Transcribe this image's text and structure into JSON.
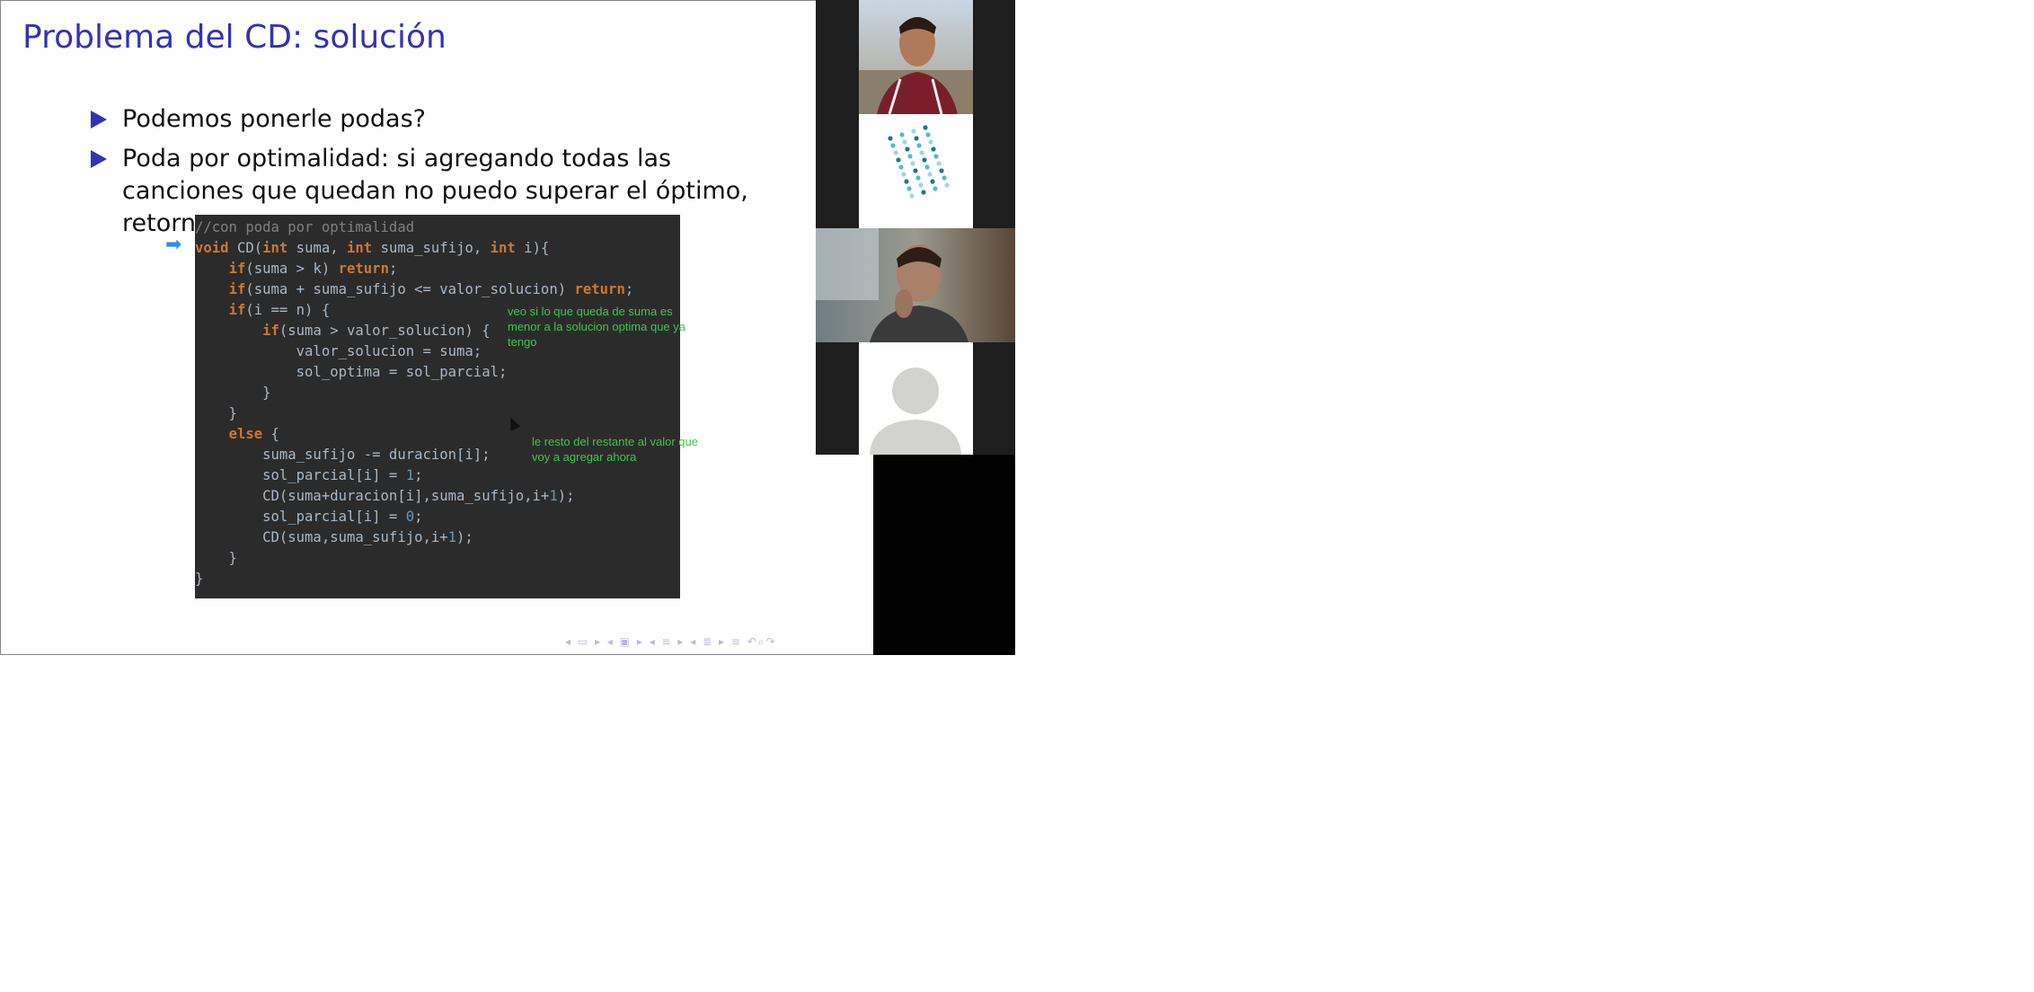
{
  "slide": {
    "title": "Problema del CD: solución",
    "bullets": [
      "Podemos ponerle podas?",
      "Poda por optimalidad: si agregando todas las canciones que quedan no puedo superar el óptimo, retornamos."
    ],
    "notes": [
      "veo si lo que queda de suma es menor a la solucion optima que ya tengo",
      "le resto del restante al valor que voy a agregar ahora"
    ],
    "nav_icons": [
      "nav-prev-frame-icon",
      "nav-slide-icon",
      "nav-next-frame-icon",
      "nav-section-icon",
      "nav-subsection-icon",
      "nav-toc-icon",
      "nav-align-icon",
      "nav-search-icon",
      "nav-undo-icon"
    ]
  },
  "code_lines": [
    "//con poda por optimalidad",
    "void CD(int suma, int suma_sufijo, int i){",
    "    if(suma > k) return;",
    "    if(suma + suma_sufijo <= valor_solucion) return;",
    "    if(i == n) {",
    "        if(suma > valor_solucion) {",
    "            valor_solucion = suma;",
    "            sol_optima = sol_parcial;",
    "        }",
    "    }",
    "    else {",
    "        suma_sufijo -= duracion[i];",
    "        sol_parcial[i] = 1;",
    "        CD(suma+duracion[i],suma_sufijo,i+1);",
    "        sol_parcial[i] = 0;",
    "        CD(suma,suma_sufijo,i+1);",
    "    }",
    "}"
  ],
  "participants": [
    {
      "type": "camera",
      "label": "participant-1"
    },
    {
      "type": "logo",
      "label": "participant-logo"
    },
    {
      "type": "camera",
      "label": "participant-2"
    },
    {
      "type": "avatar",
      "label": "participant-no-video"
    }
  ],
  "colors": {
    "title": "#3333b3",
    "code_bg": "#2b2b2b",
    "keyword": "#cc7832",
    "note": "#39c84a",
    "arrow": "#2e8fe0"
  }
}
